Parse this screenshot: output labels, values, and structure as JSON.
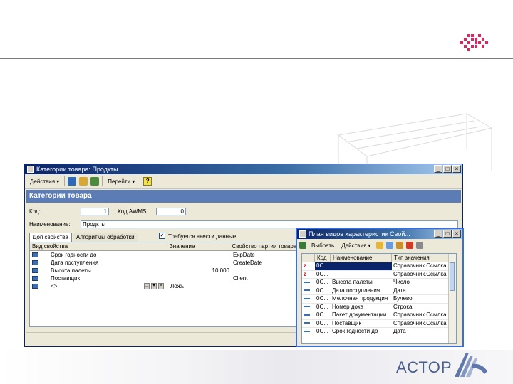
{
  "slide": {
    "brand_text": "АСТОР",
    "accent_color": "#e0245e",
    "brand_color": "#4a5f8c"
  },
  "main_window": {
    "title": "Категории товара: Продкты",
    "toolbar": {
      "actions_label": "Действия ▾",
      "goto_label": "Перейти ▾",
      "help_label": "?"
    },
    "header": "Категории товара",
    "code_label": "Код:",
    "code_value": "1",
    "wms_label": "Код AWMS:",
    "wms_value": "0",
    "name_label": "Наименование:",
    "name_value": "Продкты",
    "tabs": [
      {
        "label": "Доп свойства",
        "active": true
      },
      {
        "label": "Алгоритмы обработки",
        "active": false
      }
    ],
    "checkbox_label": "Требуется ввести данные",
    "grid": {
      "columns": [
        "Вид свойства",
        "Значение",
        "Свойство партии товара"
      ],
      "rows": [
        {
          "name": "Срок годности до",
          "value": "",
          "prop": "ExpDate"
        },
        {
          "name": "Дата поступления",
          "value": "",
          "prop": "CreateDate"
        },
        {
          "name": "Высота палеты",
          "value": "10,000",
          "prop": ""
        },
        {
          "name": "Поставщик",
          "value": "",
          "prop": "Client"
        },
        {
          "name": "<>",
          "value": "Ложь",
          "prop": ""
        }
      ]
    }
  },
  "picker_window": {
    "title": "План видов характеристик Свой...",
    "toolbar": {
      "select_label": "Выбрать",
      "actions_label": "Действия ▾"
    },
    "grid": {
      "columns": [
        "Код",
        "Наименование",
        "Тип значения"
      ],
      "rows": [
        {
          "mark": "z",
          "code": "0С...",
          "name": "",
          "type": "Справочник.Ссылка"
        },
        {
          "mark": "z",
          "code": "0С...",
          "name": "",
          "type": "Справочник.Ссылка"
        },
        {
          "mark": "-",
          "code": "0С...",
          "name": "Высота палеты",
          "type": "Число"
        },
        {
          "mark": "-",
          "code": "0С...",
          "name": "Дата поступления",
          "type": "Дата"
        },
        {
          "mark": "-",
          "code": "0С...",
          "name": "Мелочная продукция",
          "type": "Булево"
        },
        {
          "mark": "-",
          "code": "0С...",
          "name": "Номер дока",
          "type": "Строка"
        },
        {
          "mark": "-",
          "code": "0С...",
          "name": "Пакет документации",
          "type": "Справочник.Ссылка"
        },
        {
          "mark": "-",
          "code": "0С...",
          "name": "Поставщик",
          "type": "Справочник.Ссылка"
        },
        {
          "mark": "-",
          "code": "0С...",
          "name": "Срок годности до",
          "type": "Дата"
        }
      ]
    }
  }
}
